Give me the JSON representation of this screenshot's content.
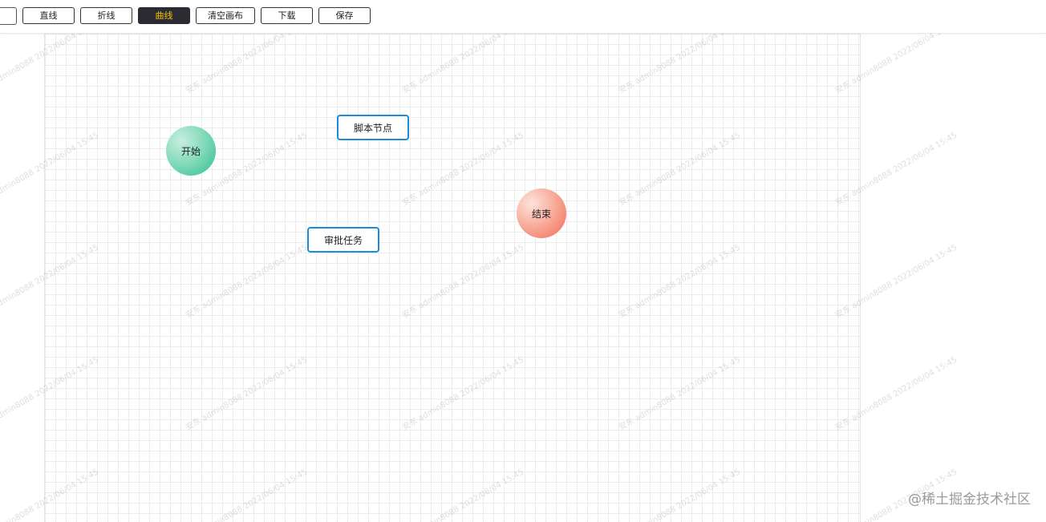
{
  "toolbar": {
    "buttons": [
      {
        "label": "直线",
        "active": false
      },
      {
        "label": "折线",
        "active": false
      },
      {
        "label": "曲线",
        "active": true
      },
      {
        "label": "清空画布",
        "active": false
      },
      {
        "label": "下载",
        "active": false
      },
      {
        "label": "保存",
        "active": false
      }
    ],
    "active_text_color": "#f5c000",
    "active_bg_color": "#2b2b33"
  },
  "canvas": {
    "nodes": {
      "start": {
        "label": "开始",
        "type": "circle",
        "color": "#2bbf8a"
      },
      "end": {
        "label": "结束",
        "type": "circle",
        "color": "#f06b55"
      },
      "script": {
        "label": "脚本节点",
        "type": "rect",
        "border_color": "#1a8cd8"
      },
      "approval": {
        "label": "审批任务",
        "type": "rect",
        "border_color": "#1a8cd8"
      }
    },
    "watermark_text": "安东 admin8088 2022/06/04 15:45"
  },
  "brand": {
    "text": "@稀土掘金技术社区"
  }
}
